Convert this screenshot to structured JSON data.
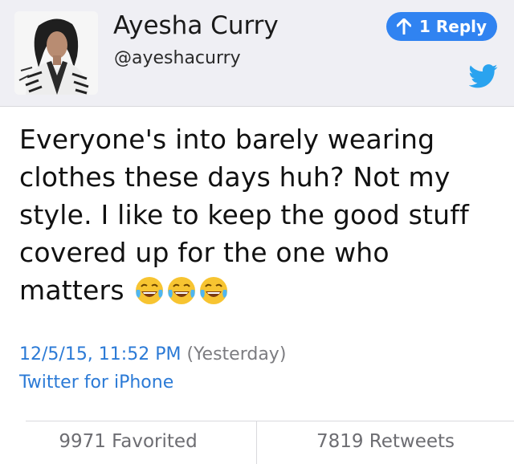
{
  "tweet": {
    "author_name": "Ayesha Curry",
    "author_handle": "@ayeshacurry",
    "reply_label": "1 Reply",
    "text": "Everyone's into barely wearing clothes these days huh? Not my style. I like to keep the good stuff covered up for the one who matters",
    "date": "12/5/15, 11:52 PM",
    "relative_time": "(Yesterday)",
    "source": "Twitter for iPhone",
    "favorited": "9971 Favorited",
    "retweets": "7819 Retweets"
  },
  "icons": {
    "reply": "up-arrow-icon",
    "brand": "twitter-bird-icon",
    "emoji": "face-with-tears-of-joy-emoji"
  },
  "colors": {
    "link": "#2b7ad6",
    "accent": "#3083f1",
    "header_bg": "#efeff4",
    "muted": "#6d6d72"
  }
}
